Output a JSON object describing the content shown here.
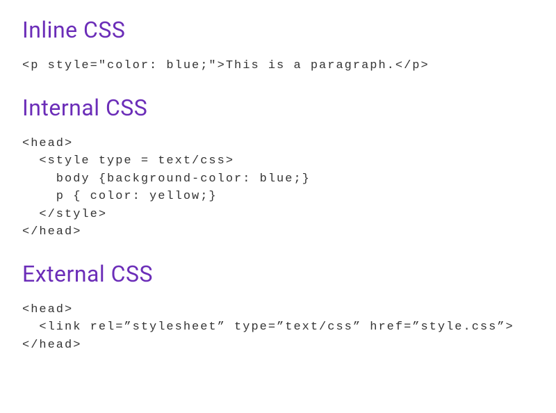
{
  "sections": {
    "inline": {
      "heading": "Inline CSS",
      "code": "<p style=\"color: blue;\">This is a paragraph.</p>"
    },
    "internal": {
      "heading": "Internal CSS",
      "code": "<head>\n  <style type = text/css>\n    body {background-color: blue;}\n    p { color: yellow;}\n  </style>\n</head>"
    },
    "external": {
      "heading": "External CSS",
      "code": "<head>\n  <link rel=”stylesheet” type=”text/css” href=”style.css”>\n</head>"
    }
  }
}
